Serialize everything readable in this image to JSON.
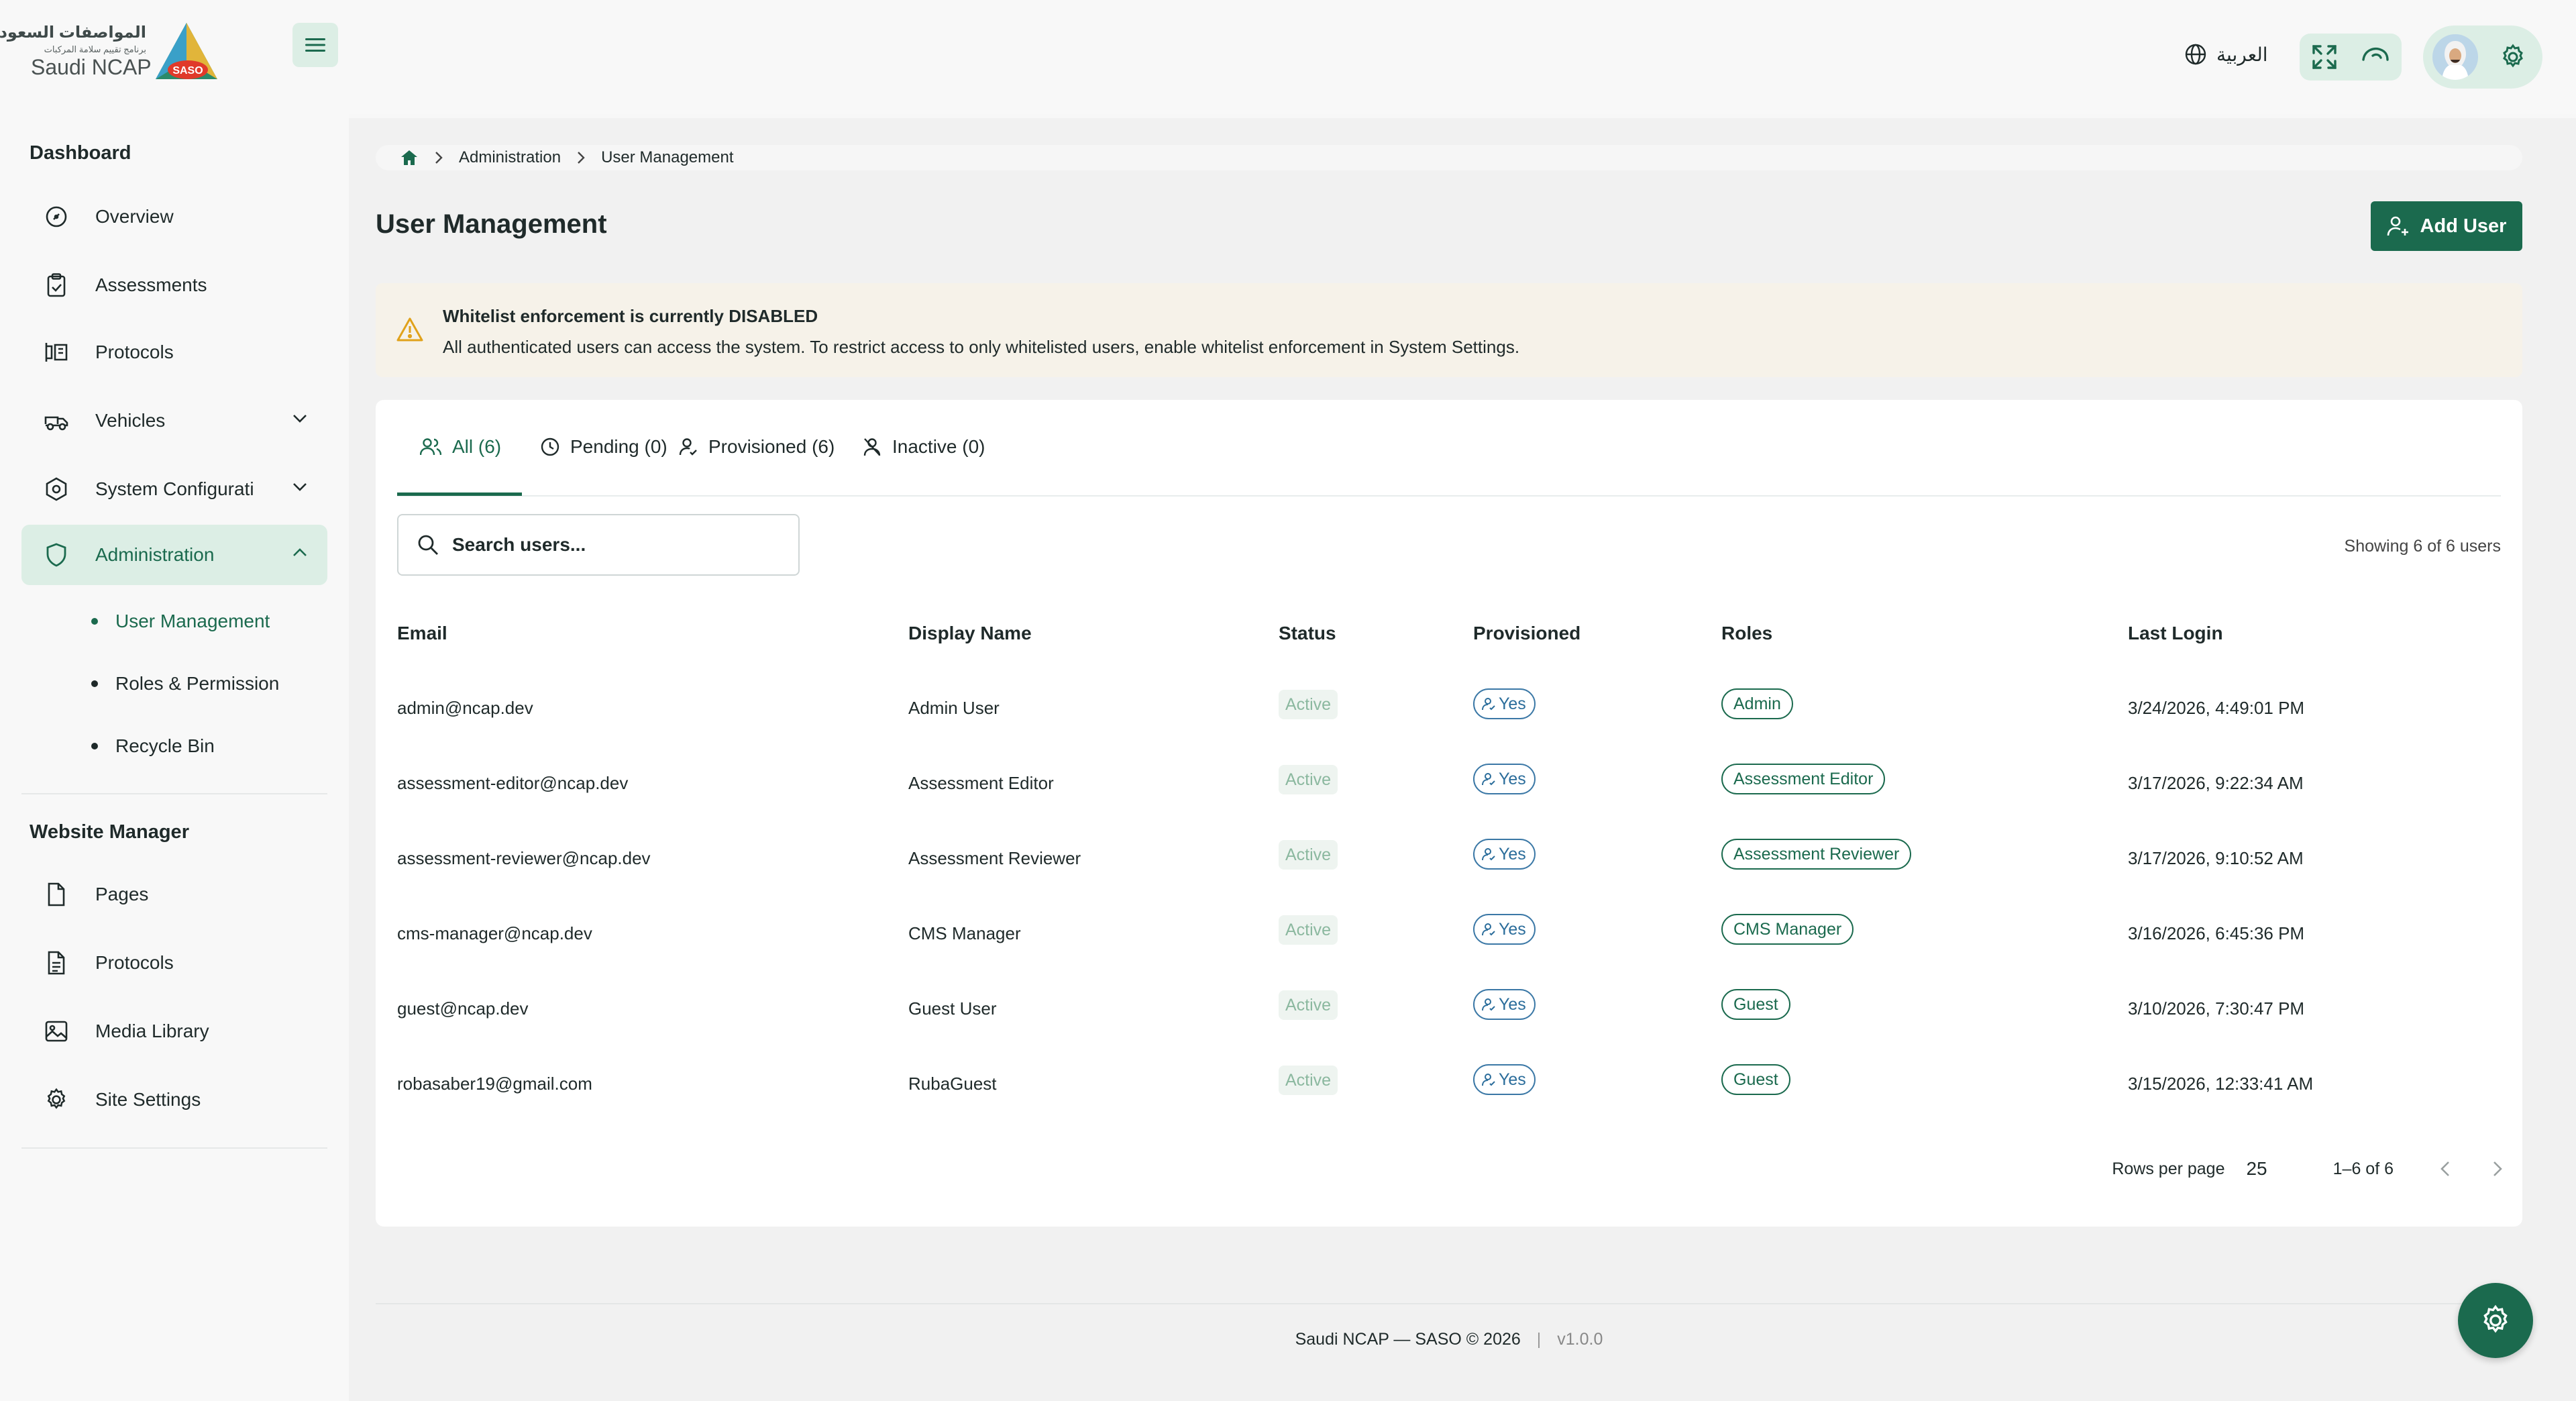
{
  "brand": {
    "arabic_title": "المواصفات السعودية",
    "arabic_subtitle": "برنامج تقييم سلامة المركبات",
    "name": "Saudi NCAP",
    "badge": "SASO"
  },
  "header": {
    "language": "العربية"
  },
  "sidebar": {
    "dashboard_title": "Dashboard",
    "items": [
      {
        "label": "Overview"
      },
      {
        "label": "Assessments"
      },
      {
        "label": "Protocols"
      },
      {
        "label": "Vehicles"
      },
      {
        "label": "System Configurati"
      },
      {
        "label": "Administration"
      }
    ],
    "admin_sub": [
      {
        "label": "User Management"
      },
      {
        "label": "Roles & Permission"
      },
      {
        "label": "Recycle Bin"
      }
    ],
    "website_title": "Website Manager",
    "website_items": [
      {
        "label": "Pages"
      },
      {
        "label": "Protocols"
      },
      {
        "label": "Media Library"
      },
      {
        "label": "Site Settings"
      }
    ]
  },
  "breadcrumb": {
    "items": [
      "Administration",
      "User Management"
    ]
  },
  "page": {
    "title": "User Management",
    "add_user_label": "Add User"
  },
  "alert": {
    "title": "Whitelist enforcement is currently DISABLED",
    "message": "All authenticated users can access the system. To restrict access to only whitelisted users, enable whitelist enforcement in System Settings."
  },
  "tabs": [
    {
      "label": "All (6)"
    },
    {
      "label": "Pending (0)"
    },
    {
      "label": "Provisioned (6)"
    },
    {
      "label": "Inactive (0)"
    }
  ],
  "search": {
    "placeholder": "Search users..."
  },
  "showing": "Showing 6 of 6 users",
  "table": {
    "columns": [
      "Email",
      "Display Name",
      "Status",
      "Provisioned",
      "Roles",
      "Last Login"
    ],
    "rows": [
      {
        "email": "admin@ncap.dev",
        "name": "Admin User",
        "status": "Active",
        "provisioned": "Yes",
        "role": "Admin",
        "last_login": "3/24/2026, 4:49:01 PM"
      },
      {
        "email": "assessment-editor@ncap.dev",
        "name": "Assessment Editor",
        "status": "Active",
        "provisioned": "Yes",
        "role": "Assessment Editor",
        "last_login": "3/17/2026, 9:22:34 AM"
      },
      {
        "email": "assessment-reviewer@ncap.dev",
        "name": "Assessment Reviewer",
        "status": "Active",
        "provisioned": "Yes",
        "role": "Assessment Reviewer",
        "last_login": "3/17/2026, 9:10:52 AM"
      },
      {
        "email": "cms-manager@ncap.dev",
        "name": "CMS Manager",
        "status": "Active",
        "provisioned": "Yes",
        "role": "CMS Manager",
        "last_login": "3/16/2026, 6:45:36 PM"
      },
      {
        "email": "guest@ncap.dev",
        "name": "Guest User",
        "status": "Active",
        "provisioned": "Yes",
        "role": "Guest",
        "last_login": "3/10/2026, 7:30:47 PM"
      },
      {
        "email": "robasaber19@gmail.com",
        "name": "RubaGuest",
        "status": "Active",
        "provisioned": "Yes",
        "role": "Guest",
        "last_login": "3/15/2026, 12:33:41 AM"
      }
    ]
  },
  "pagination": {
    "rows_per_page_label": "Rows per page",
    "rows_per_page": "25",
    "range": "1–6 of 6"
  },
  "footer": {
    "copyright": "Saudi NCAP — SASO © 2026",
    "separator": "|",
    "version": "v1.0.0"
  },
  "colors": {
    "primary": "#1b6a4e",
    "accent_bg": "#dceee5",
    "info_chip": "#2b6d9b",
    "alert_bg": "#f6f2e9",
    "warning_icon": "#e0a21b"
  },
  "icons": [
    "menu-icon",
    "globe-icon",
    "fullscreen-icon",
    "theme-icon",
    "settings-icon",
    "home-icon",
    "add-user-icon",
    "warning-icon",
    "users-icon",
    "clock-icon",
    "user-check-icon",
    "user-off-icon",
    "search-icon",
    "chevron-left-icon",
    "chevron-right-icon"
  ]
}
